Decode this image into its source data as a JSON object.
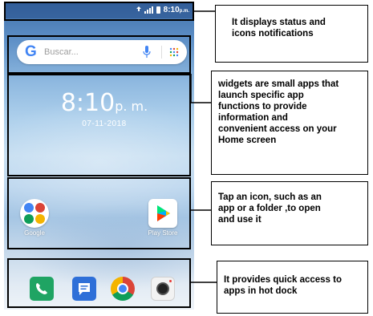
{
  "status_bar": {
    "time": "8:10",
    "ampm": "p.m.",
    "icons": [
      "sync-icon",
      "signal-icon",
      "battery-icon"
    ]
  },
  "search": {
    "logo": "G",
    "placeholder": "Buscar...",
    "icons": [
      "mic-icon",
      "apps-grid-icon"
    ]
  },
  "clock_widget": {
    "time": "8:10",
    "ampm": "p. m.",
    "date": "07-11-2018"
  },
  "home_apps": [
    {
      "label": "Google",
      "icon": "google-folder-icon"
    },
    {
      "label": "Play Store",
      "icon": "play-store-icon"
    }
  ],
  "dock": [
    {
      "icon": "phone-icon"
    },
    {
      "icon": "messages-icon"
    },
    {
      "icon": "chrome-icon"
    },
    {
      "icon": "camera-icon"
    }
  ],
  "callouts": {
    "status": "It displays status and\nicons notifications",
    "widgets": "widgets are small apps that\nlaunch specific app\nfunctions to provide\ninformation and\nconvenient access on your\nHome screen",
    "icons": "Tap an icon, such as an\napp or a folder ,to open\nand use it",
    "dock": "It provides quick access to\napps in hot dock"
  },
  "colors": {
    "highlight_border": "#000000",
    "wallpaper_top": "#3f6fa8",
    "wallpaper_bottom": "#eef3f8"
  }
}
